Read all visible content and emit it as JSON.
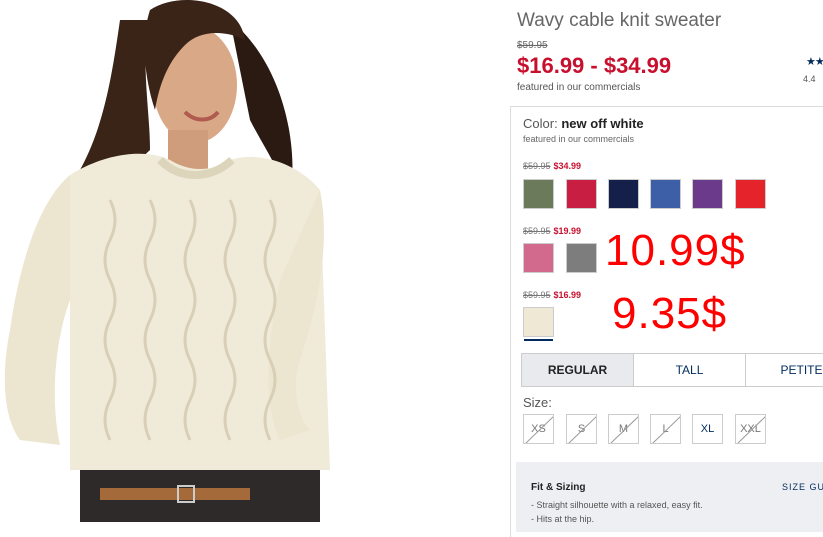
{
  "product": {
    "title": "Wavy cable knit sweater",
    "original_price": "$59.95",
    "sale_price": "$16.99 - $34.99",
    "featured_note": "featured in our commercials",
    "rating": "4.4",
    "stars_glyph": "★★"
  },
  "color": {
    "label": "Color:",
    "selected_name": "new off white",
    "featured_note": "featured in our commercials",
    "groups": [
      {
        "old_price": "$59.95",
        "new_price": "$34.99",
        "swatches": [
          {
            "name": "olive",
            "color": "#6b7a5a"
          },
          {
            "name": "red-pink",
            "color": "#c81e42"
          },
          {
            "name": "navy",
            "color": "#14204a"
          },
          {
            "name": "blue",
            "color": "#3c5fa8"
          },
          {
            "name": "purple",
            "color": "#6b3a8a"
          },
          {
            "name": "red",
            "color": "#e4232b"
          }
        ]
      },
      {
        "old_price": "$59.95",
        "new_price": "$19.99",
        "swatches": [
          {
            "name": "pink",
            "color": "#d16a8d"
          },
          {
            "name": "grey",
            "color": "#7d7d7d"
          }
        ]
      },
      {
        "old_price": "$59.95",
        "new_price": "$16.99",
        "swatches": [
          {
            "name": "off-white",
            "color": "#efe8d4"
          }
        ]
      }
    ]
  },
  "annotations": {
    "first": "10.99$",
    "second": "9.35$"
  },
  "fit_tabs": [
    {
      "label": "REGULAR",
      "active": true
    },
    {
      "label": "TALL",
      "active": false
    },
    {
      "label": "PETITE",
      "active": false
    }
  ],
  "sizes": {
    "label": "Size:",
    "options": [
      {
        "label": "XS",
        "available": false
      },
      {
        "label": "S",
        "available": false
      },
      {
        "label": "M",
        "available": false
      },
      {
        "label": "L",
        "available": false
      },
      {
        "label": "XL",
        "available": true
      },
      {
        "label": "XXL",
        "available": false
      }
    ]
  },
  "fit_sizing": {
    "title": "Fit & Sizing",
    "size_guide": "SIZE GU",
    "bullets": [
      "- Straight silhouette with a relaxed, easy fit.",
      "- Hits at the hip."
    ]
  }
}
